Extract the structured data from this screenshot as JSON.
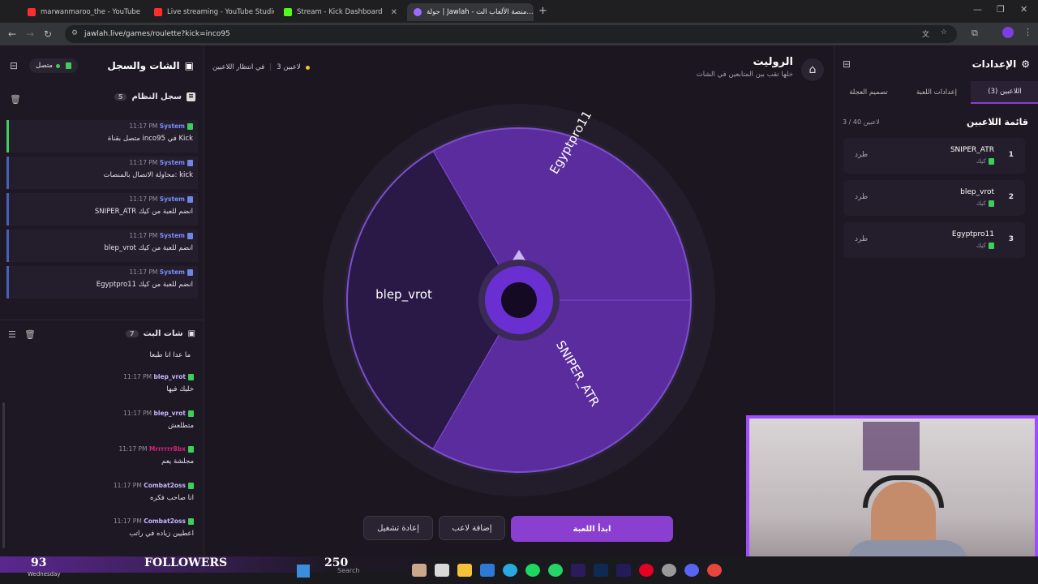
{
  "browser": {
    "tabs": [
      {
        "title": "marwanmaroo_the - YouTube",
        "icon": "youtube-icon",
        "color": "#ff2d2d"
      },
      {
        "title": "Live streaming - YouTube Studio",
        "icon": "youtube-studio-icon",
        "color": "#ff2d2d"
      },
      {
        "title": "Stream - Kick Dashboard",
        "icon": "kick-icon",
        "color": "#53fc18"
      },
      {
        "title": "جولة | Jawlah - منصة الألعاب الت...",
        "icon": "jawlah-icon",
        "color": "#9a6bff"
      }
    ],
    "url": "jawlah.live/games/roulette?kick=inco95"
  },
  "left": {
    "title": "الشات والسجل",
    "status": "متصل",
    "log_title": "سجل النظام",
    "log_count": "5",
    "log": [
      {
        "user": "System",
        "time": "11:17 PM",
        "msg": "متصل بقناة inco95 في Kick",
        "accent": "green"
      },
      {
        "user": "System",
        "time": "11:17 PM",
        "msg": "محاولة الاتصال بالمنصات: kick",
        "accent": "blue"
      },
      {
        "user": "System",
        "time": "11:17 PM",
        "msg": "SNIPER_ATR انضم للعبة من كيك",
        "accent": "blue"
      },
      {
        "user": "System",
        "time": "11:17 PM",
        "msg": "blep_vrot انضم للعبة من كيك",
        "accent": "blue"
      },
      {
        "user": "System",
        "time": "11:17 PM",
        "msg": "Egyptpro11 انضم للعبة من كيك",
        "accent": "blue"
      }
    ],
    "chat_title": "شات البث",
    "chat_count": "7",
    "chat_top": "ما عدا انا طبعا",
    "chat": [
      {
        "user": "blep_vrot",
        "time": "11:17 PM",
        "msg": "خليك فيها",
        "color": "#c7b6ff"
      },
      {
        "user": "blep_vrot",
        "time": "11:17 PM",
        "msg": "متطلعش",
        "color": "#c7b6ff"
      },
      {
        "user": "Mrrrrrr8bx",
        "time": "11:17 PM",
        "msg": "مجلشة يعم",
        "color": "#d4237a"
      },
      {
        "user": "Combat2oss",
        "time": "11:17 PM",
        "msg": "انا صاحب فكره",
        "color": "#c7b6ff"
      },
      {
        "user": "Combat2oss",
        "time": "11:17 PM",
        "msg": "اعطيين زياده في راتب",
        "color": "#c7b6ff"
      }
    ]
  },
  "center": {
    "title": "الروليت",
    "subtitle": "خلها تقب بين المتابعين في الشات",
    "waiting": "في انتظار اللاعبين",
    "players_count": "3 لاعبين",
    "segments": [
      "Egyptpro11",
      "blep_vrot",
      "SNIPER_ATR"
    ],
    "start_label": "ابدأ اللعبة",
    "add_label": "إضافة لاعب",
    "reset_label": "إعادة تشغيل"
  },
  "right": {
    "title": "الإعدادات",
    "tabs": [
      "اللاعبين (3)",
      "إعدادات اللعبة",
      "تصميم العجلة"
    ],
    "list_title": "قائمة اللاعبين",
    "list_count": "3 / 40 لاعبين",
    "kick_label": "طرد",
    "platform": "كيك",
    "players": [
      {
        "num": "1",
        "name": "SNIPER_ATR"
      },
      {
        "num": "2",
        "name": "blep_vrot"
      },
      {
        "num": "3",
        "name": "Egyptpro11"
      }
    ]
  },
  "overlay": {
    "count_left": "93",
    "day": "Wednesday",
    "followers": "FOLLOWERS",
    "count_right": "250",
    "search": "Search"
  },
  "colors": {
    "accent": "#8a3fd0",
    "kick": "#3ecf5a",
    "wheel_light": "#5b2c9e",
    "wheel_dark": "#2a1846"
  }
}
